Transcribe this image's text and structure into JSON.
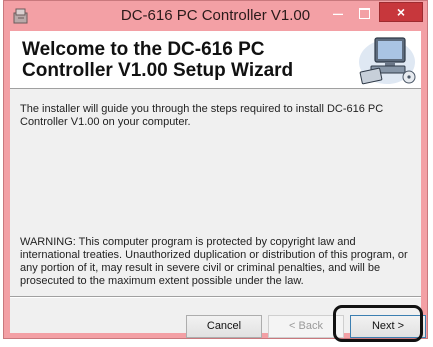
{
  "window": {
    "title": "DC-616 PC Controller V1.00",
    "close_glyph": "×",
    "minimize_glyph": "–"
  },
  "header": {
    "title": "Welcome to the DC-616 PC Controller V1.00 Setup Wizard",
    "icon": "computer-install-icon"
  },
  "body": {
    "intro": "The installer will guide you through the steps required to install DC-616 PC Controller V1.00 on your computer.",
    "warning": "WARNING: This computer program is protected by copyright law and international treaties. Unauthorized duplication or distribution of this program, or any portion of it, may result in severe civil or criminal penalties, and will be prosecuted to the maximum extent possible under the law."
  },
  "buttons": {
    "cancel": "Cancel",
    "back": "< Back",
    "next": "Next >"
  },
  "colors": {
    "titlebar": "#f3a0a5",
    "close": "#c7373c",
    "client": "#f0f0f0"
  }
}
